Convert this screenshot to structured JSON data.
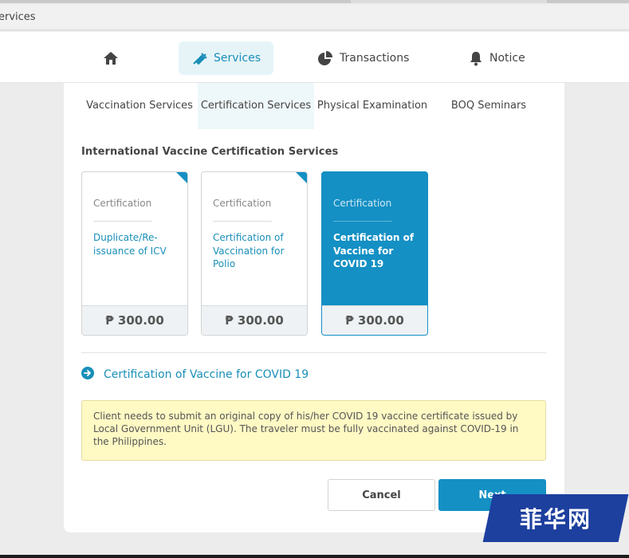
{
  "browser": {
    "address_text": "ervices"
  },
  "nav": {
    "home_icon": "home-icon",
    "services": {
      "label": "Services",
      "icon": "syringe-icon"
    },
    "transactions": {
      "label": "Transactions",
      "icon": "pie-chart-icon"
    },
    "notice": {
      "label": "Notice",
      "icon": "bell-icon"
    },
    "accent": "#1a8fb8"
  },
  "subtabs": [
    {
      "label": "Vaccination Services"
    },
    {
      "label": "Certification Services"
    },
    {
      "label": "Physical Examination"
    },
    {
      "label": "BOQ Seminars"
    }
  ],
  "section_heading": "International Vaccine Certification Services",
  "cards": [
    {
      "category": "Certification",
      "name": "Duplicate/Re-issuance of ICV",
      "price": "₱ 300.00"
    },
    {
      "category": "Certification",
      "name": "Certification of Vaccination for Polio",
      "price": "₱ 300.00"
    },
    {
      "category": "Certification",
      "name": "Certification of Vaccine for COVID 19",
      "price": "₱ 300.00"
    }
  ],
  "selected_service": "Certification of Vaccine for COVID 19",
  "notice_text": "Client needs to submit an original copy of his/her COVID 19 vaccine certificate issued by Local Government Unit (LGU). The traveler must be fully vaccinated against COVID-19 in the Philippines.",
  "buttons": {
    "cancel": "Cancel",
    "next": "Next"
  },
  "watermark": "菲华网",
  "colors": {
    "primary": "#1490c4",
    "notice_bg": "#fff9c4"
  }
}
